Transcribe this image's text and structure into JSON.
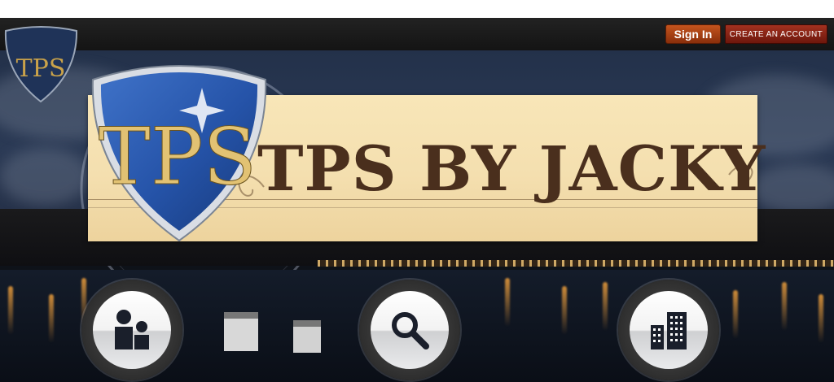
{
  "topbar": {
    "signin_label": "Sign In",
    "create_account_label": "CREATE AN ACCOUNT"
  },
  "logo": {
    "mini_letters": "TPS",
    "big_letters": "TPS"
  },
  "banner": {
    "title": "TPS BY JACKY"
  },
  "nav_buttons": [
    {
      "name": "people-icon"
    },
    {
      "name": "search-icon"
    },
    {
      "name": "buildings-icon"
    }
  ],
  "colors": {
    "signin": "#c4541d",
    "create_account": "#a3311f",
    "shield_blue": "#2553a8",
    "banner_paper": "#f4dfaf",
    "title_brown": "#4a2f1d"
  }
}
